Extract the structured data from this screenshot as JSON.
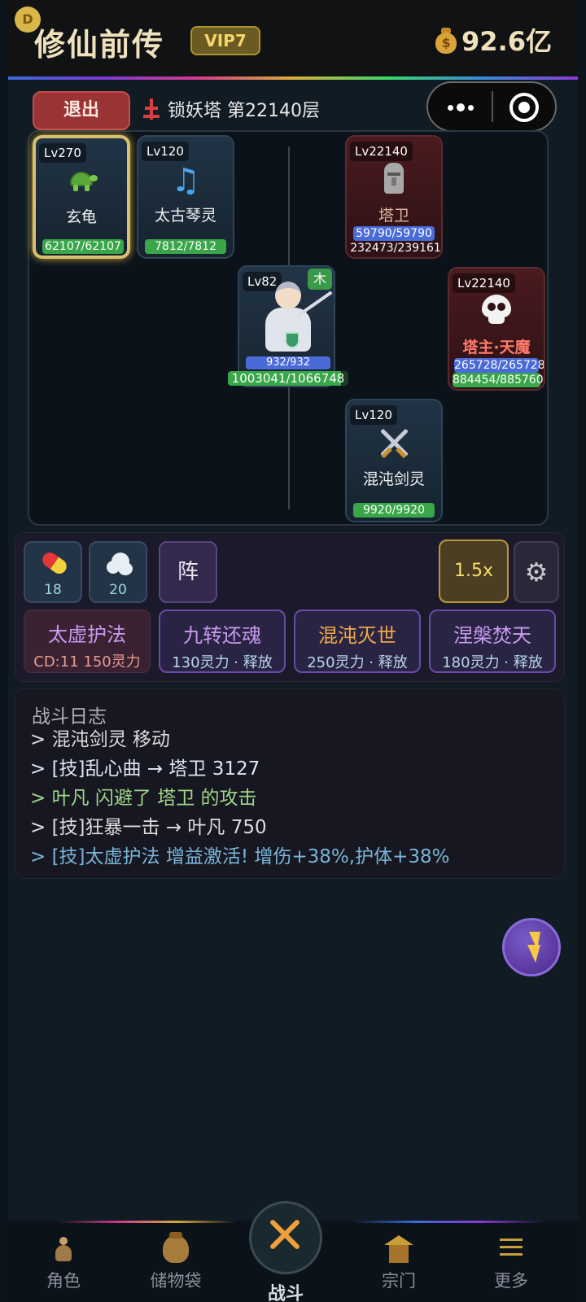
{
  "header": {
    "avatar_letter": "D",
    "title": "修仙前传",
    "vip": "VIP7",
    "currency": "92.6亿"
  },
  "topbar": {
    "exit_label": "退出",
    "location": "锁妖塔 第22140层"
  },
  "allies": [
    {
      "level": "Lv270",
      "name": "玄龟",
      "hp": "62107/62107",
      "icon": "turtle-icon"
    },
    {
      "level": "Lv120",
      "name": "太古琴灵",
      "hp": "7812/7812",
      "icon": "music-note-icon"
    },
    {
      "level": "Lv120",
      "name": "混沌剑灵",
      "hp": "9920/9920",
      "icon": "crossed-swords-icon"
    }
  ],
  "hero": {
    "level": "Lv82",
    "element": "木",
    "mp": "932/932",
    "hp": "1003041/1066748",
    "hp_fraction": 0.94
  },
  "enemies": [
    {
      "level": "Lv22140",
      "name": "塔卫",
      "mp": "59790/59790",
      "hp": "232473/239161",
      "icon": "moai-icon"
    },
    {
      "level": "Lv22140",
      "name": "塔主·天魔",
      "mp": "265728/265728",
      "hp": "884454/885760",
      "icon": "skull-icon"
    }
  ],
  "controls": {
    "pill_count": "18",
    "wind_count": "20",
    "formation_label": "阵",
    "speed_label": "1.5x"
  },
  "skills": [
    {
      "name": "太虚护法",
      "sub": "CD:11  150灵力"
    },
    {
      "name": "九转还魂",
      "sub": "130灵力 · 释放"
    },
    {
      "name": "混沌灭世",
      "sub": "250灵力 · 释放"
    },
    {
      "name": "涅槃焚天",
      "sub": "180灵力 · 释放"
    }
  ],
  "log": {
    "title": "战斗日志",
    "lines": [
      "> 混沌剑灵 移动",
      "> [技]乱心曲 → 塔卫 3127",
      "> 叶凡 闪避了 塔卫 的攻击",
      "> [技]狂暴一击 → 叶凡 750",
      "> [技]太虚护法 增益激活! 增伤+38%,护体+38%"
    ],
    "colors": [
      "#dcdcdc",
      "#dce6f2",
      "#9fd68a",
      "#dcdcdc",
      "#79b4d8"
    ]
  },
  "nav": {
    "items": [
      "角色",
      "储物袋",
      "战斗",
      "宗门",
      "更多"
    ]
  }
}
